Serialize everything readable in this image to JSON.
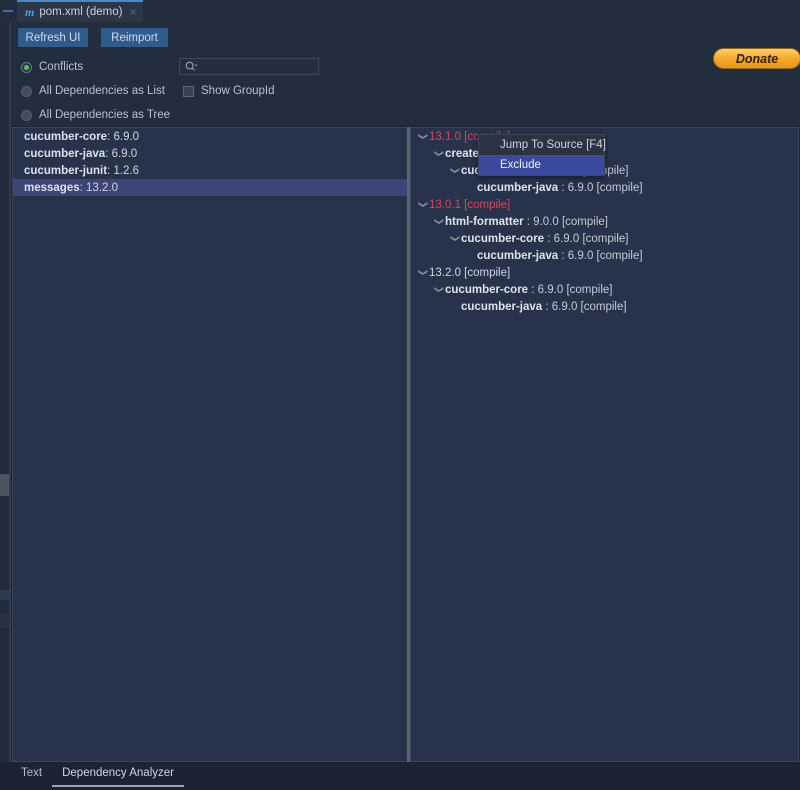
{
  "window": {
    "tab_title": "pom.xml (demo)",
    "tab_icon": "maven-m-icon",
    "tab_close": "×",
    "collapse_icon": "—"
  },
  "toolbar": {
    "refresh_label": "Refresh UI",
    "reimport_label": "Reimport",
    "donate_label": "Donate",
    "search_placeholder": "",
    "search_value": "",
    "options": [
      {
        "label": "Conflicts",
        "type": "radio",
        "selected": true
      },
      {
        "label": "All Dependencies as List",
        "type": "radio",
        "selected": false
      },
      {
        "label": "All Dependencies as Tree",
        "type": "radio",
        "selected": false
      }
    ],
    "show_groupid": {
      "label": "Show GroupId",
      "checked": false
    }
  },
  "left_panel": {
    "rows": [
      {
        "artifact": "cucumber-core",
        "version": "6.9.0",
        "selected": false
      },
      {
        "artifact": "cucumber-java",
        "version": "6.9.0",
        "selected": false
      },
      {
        "artifact": "cucumber-junit",
        "version": "1.2.6",
        "selected": false
      },
      {
        "artifact": "messages",
        "version": "13.2.0",
        "selected": true
      }
    ]
  },
  "right_panel": {
    "rows": [
      {
        "depth": 0,
        "chevron": true,
        "artifact": "",
        "text": "13.1.0 [compile]",
        "conflict": true
      },
      {
        "depth": 1,
        "chevron": true,
        "artifact": "create",
        "text": "",
        "conflict": false
      },
      {
        "depth": 2,
        "chevron": true,
        "artifact": "cucumber-core",
        "text": " : 6.9.0 [compile]",
        "conflict": false
      },
      {
        "depth": 3,
        "chevron": false,
        "artifact": "cucumber-java",
        "text": " : 6.9.0 [compile]",
        "conflict": false
      },
      {
        "depth": 0,
        "chevron": true,
        "artifact": "",
        "text": "13.0.1 [compile]",
        "conflict": true
      },
      {
        "depth": 1,
        "chevron": true,
        "artifact": "html-formatter",
        "text": " : 9.0.0 [compile]",
        "conflict": false
      },
      {
        "depth": 2,
        "chevron": true,
        "artifact": "cucumber-core",
        "text": " : 6.9.0 [compile]",
        "conflict": false
      },
      {
        "depth": 3,
        "chevron": false,
        "artifact": "cucumber-java",
        "text": " : 6.9.0 [compile]",
        "conflict": false
      },
      {
        "depth": 0,
        "chevron": true,
        "artifact": "",
        "text": "13.2.0 [compile]",
        "conflict": false
      },
      {
        "depth": 1,
        "chevron": true,
        "artifact": "cucumber-core",
        "text": " : 6.9.0 [compile]",
        "conflict": false
      },
      {
        "depth": 2,
        "chevron": false,
        "artifact": "cucumber-java",
        "text": " : 6.9.0 [compile]",
        "conflict": false
      }
    ]
  },
  "context_menu": {
    "items": [
      {
        "label": "Jump To Source [F4]",
        "selected": false
      },
      {
        "label": "Exclude",
        "selected": true
      }
    ]
  },
  "bottom_tabs": [
    {
      "label": "Text",
      "active": false
    },
    {
      "label": "Dependency Analyzer",
      "active": true
    }
  ],
  "colors": {
    "background": "#1c2433",
    "panel": "#26334a",
    "accent_button": "#2f5c8d",
    "donate": "#f5a623",
    "conflict_text": "#d9455f",
    "selection": "#3d4476",
    "menu_selection": "#3b4a9d"
  }
}
